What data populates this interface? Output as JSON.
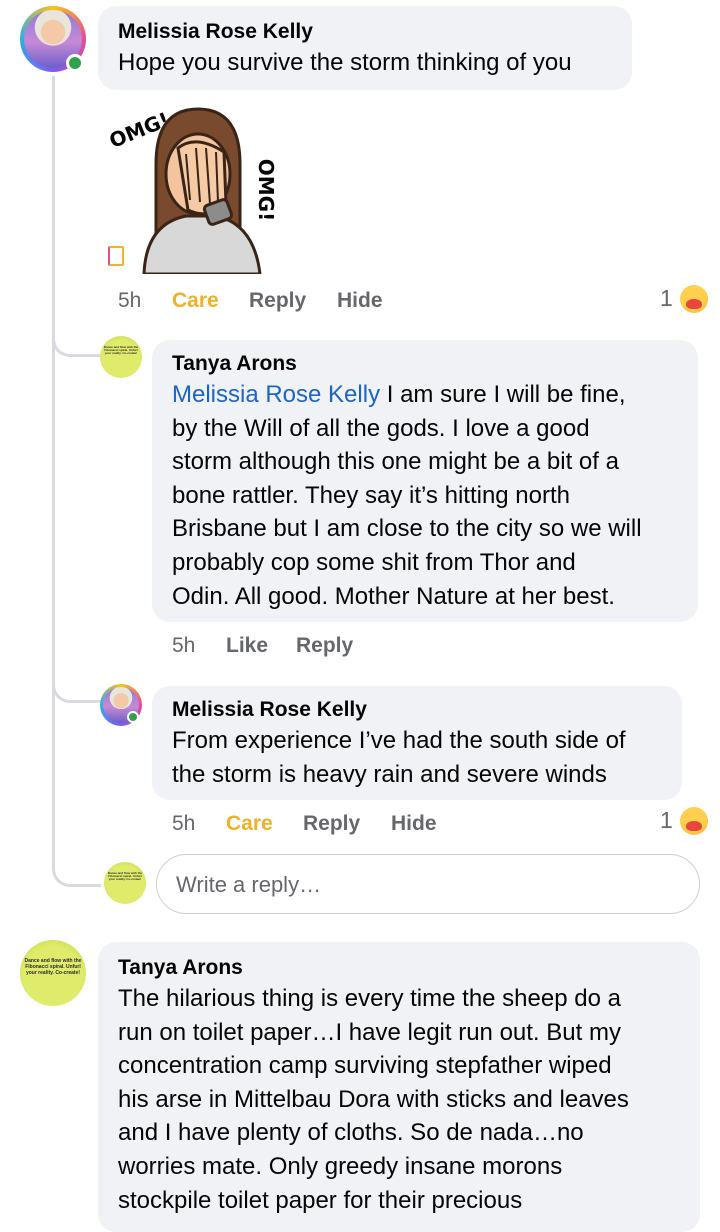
{
  "comments": [
    {
      "author": "Melissia Rose Kelly",
      "text": "Hope you survive the storm thinking of you",
      "sticker": {
        "text_left": "OMG!",
        "text_right": "OMG!"
      },
      "time": "5h",
      "reaction_label": "Care",
      "reply_label": "Reply",
      "hide_label": "Hide",
      "reaction_count": "1",
      "reaction_icon": "care-hug-emoji"
    }
  ],
  "replies": [
    {
      "author": "Tanya Arons",
      "mention": "Melissia Rose Kelly",
      "lines": [
        " I am sure I will be fine,",
        "by the Will of all the gods.  I love a good",
        "storm although this one might be a bit of a",
        "bone rattler. They say it’s hitting north",
        "Brisbane but I am close to the city so we will",
        "probably cop some shit from Thor and",
        "Odin.  All good.  Mother Nature at her best."
      ],
      "time": "5h",
      "like_label": "Like",
      "reply_label": "Reply"
    },
    {
      "author": "Melissia Rose Kelly",
      "lines": [
        "From experience I’ve had the south side of",
        "the storm is heavy rain and severe winds"
      ],
      "time": "5h",
      "reaction_label": "Care",
      "reply_label": "Reply",
      "hide_label": "Hide",
      "reaction_count": "1"
    }
  ],
  "reply_input": {
    "placeholder": "Write a reply…"
  },
  "avatar_text": {
    "tanya_small": "Dance and flow with the Fibonacci spiral. Unfurl your reality. Co-create!",
    "tanya_large": "Dance and flow with the Fibonacci spiral. Unfurl your reality. Co-create!"
  },
  "bottom_comment": {
    "author": "Tanya Arons",
    "lines": [
      "The hilarious thing is every time the sheep do a",
      "run on  toilet paper…I have legit run out.  But my",
      "concentration camp surviving stepfather wiped",
      "his arse in Mittelbau Dora with sticks and leaves",
      "and I have plenty of cloths.  So de nada…no",
      "worries mate.  Only greedy insane morons",
      "stockpile toilet paper for their precious"
    ]
  },
  "colors": {
    "care": "#f0b128",
    "link": "#1b64c8",
    "online": "#31a24c",
    "bubble": "#f0f2f5"
  }
}
